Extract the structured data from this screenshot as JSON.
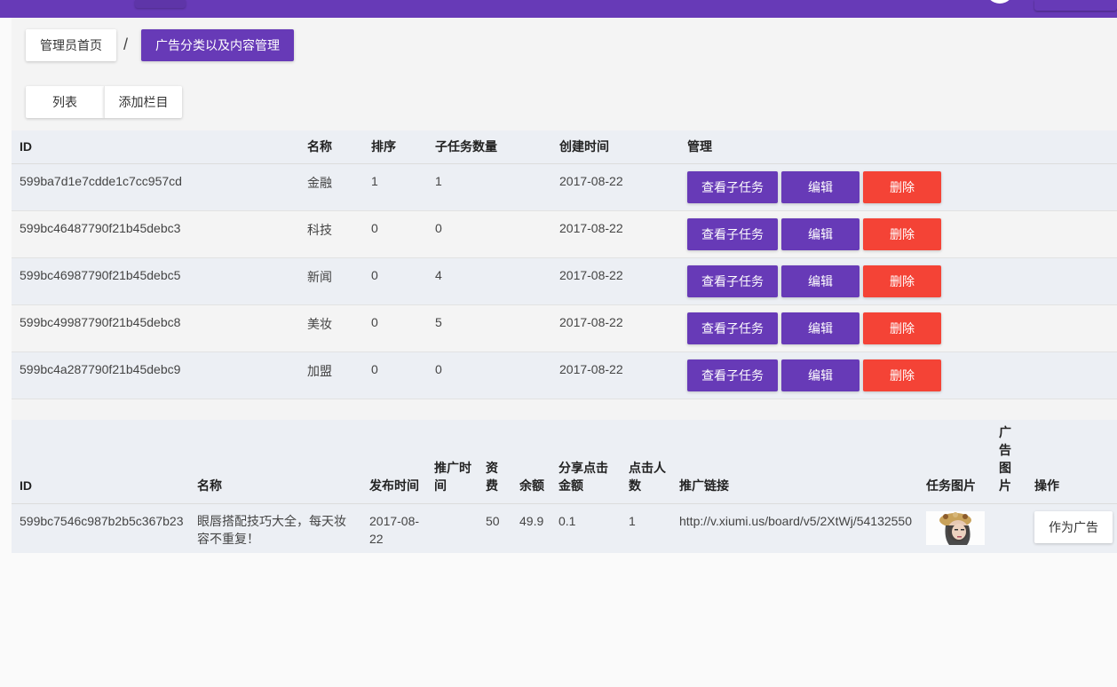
{
  "breadcrumb": {
    "home": "管理员首页",
    "separator": "/",
    "current": "广告分类以及内容管理"
  },
  "tabs": {
    "list": "列表",
    "add": "添加栏目"
  },
  "category_table": {
    "headers": [
      "ID",
      "名称",
      "排序",
      "子任务数量",
      "创建时间",
      "管理"
    ],
    "rows": [
      {
        "id": "599ba7d1e7cdde1c7cc957cd",
        "name": "金融",
        "sort": "1",
        "subtasks": "1",
        "created": "2017-08-22"
      },
      {
        "id": "599bc46487790f21b45debc3",
        "name": "科技",
        "sort": "0",
        "subtasks": "0",
        "created": "2017-08-22"
      },
      {
        "id": "599bc46987790f21b45debc5",
        "name": "新闻",
        "sort": "0",
        "subtasks": "4",
        "created": "2017-08-22"
      },
      {
        "id": "599bc49987790f21b45debc8",
        "name": "美妆",
        "sort": "0",
        "subtasks": "5",
        "created": "2017-08-22"
      },
      {
        "id": "599bc4a287790f21b45debc9",
        "name": "加盟",
        "sort": "0",
        "subtasks": "0",
        "created": "2017-08-22"
      }
    ],
    "actions": {
      "view": "查看子任务",
      "edit": "编辑",
      "delete": "删除"
    }
  },
  "task_table": {
    "headers": {
      "id": "ID",
      "name": "名称",
      "publish_time": "发布时间",
      "promo_time": "推广时间",
      "fee": "资费",
      "balance": "余额",
      "share_amount": "分享点击金额",
      "clicks": "点击人数",
      "link": "推广链接",
      "task_image": "任务图片",
      "ad_image": "广告图片",
      "ops": "操作"
    },
    "rows": [
      {
        "id": "599bc7546c987b2b5c367b23",
        "name": "眼唇搭配技巧大全，每天妆容不重复！",
        "publish_time": "2017-08-22",
        "promo_time": "",
        "fee": "50",
        "balance": "49.9",
        "share_amount": "0.1",
        "clicks": "1",
        "link": "http://v.xiumi.us/board/v5/2XtWj/54132550",
        "action": "作为广告"
      }
    ]
  },
  "colors": {
    "primary": "#673ab7",
    "danger": "#f44336",
    "row_alt": "#eceff4"
  }
}
